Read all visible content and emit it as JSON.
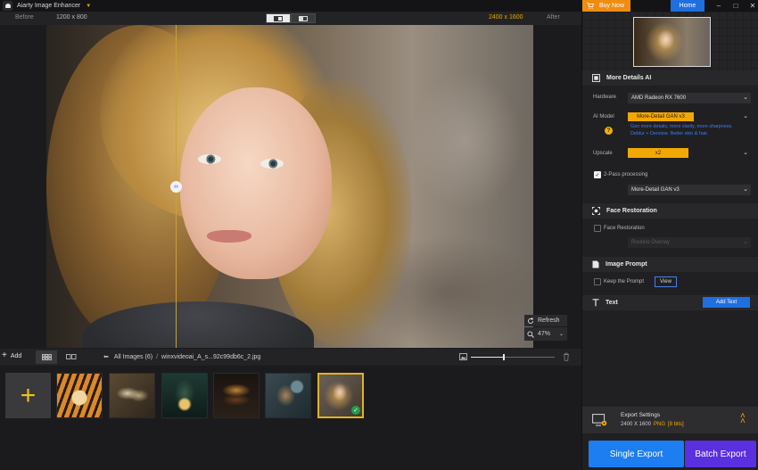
{
  "app": {
    "title": "Aiarty Image Enhancer"
  },
  "compare": {
    "before_label": "Before",
    "before_resolution": "1200 x 800",
    "after_resolution": "2400 x 1600",
    "after_label": "After"
  },
  "preview": {
    "refresh_label": "Refresh",
    "zoom_value": "47%"
  },
  "bottombar": {
    "add_label": "Add",
    "all_images": "All Images (6)",
    "separator": "/",
    "file_name": "winxvideoai_A_s...92c99db6c_2.jpg",
    "zoom_slider_level": 0.39
  },
  "thumbnails": {
    "count": 6,
    "selected_index": 6
  },
  "topbar": {
    "buy_now": "Buy Now",
    "home": "Home"
  },
  "more_details": {
    "title": "More Details AI",
    "hardware_label": "Hardware",
    "hardware_value": "AMD Radeon RX 7600",
    "ai_model_label": "AI Model",
    "ai_model_value": "More-Detail GAN  v3",
    "hint_line1": "Gen more details, more clarity, more sharpness.",
    "hint_line2": "Deblur + Denoise. Better skin & hair.",
    "upscale_label": "Upscale",
    "upscale_value": "x2",
    "two_pass_label": "2-Pass processing",
    "two_pass_checked": true,
    "two_pass_model": "More-Detail GAN  v3"
  },
  "face_restoration": {
    "title": "Face Restoration",
    "checkbox_label": "Face Restoration",
    "model": "Routine Overlay"
  },
  "image_prompt": {
    "title": "Image Prompt",
    "checkbox_label": "Keep the Prompt",
    "view_button": "View"
  },
  "text_section": {
    "title": "Text",
    "add_text_button": "Add Text"
  },
  "export": {
    "title": "Export Settings",
    "resolution": "2400 X 1600",
    "format": "PNG",
    "bits": "[8 bits]",
    "single_export": "Single Export",
    "batch_export": "Batch Export"
  },
  "colors": {
    "accent": "#f2a804",
    "primary_blue": "#1f6fe0",
    "batch_purple": "#5a2fe0",
    "buy_orange": "#f08c12",
    "hint_blue": "#3f7df2"
  }
}
